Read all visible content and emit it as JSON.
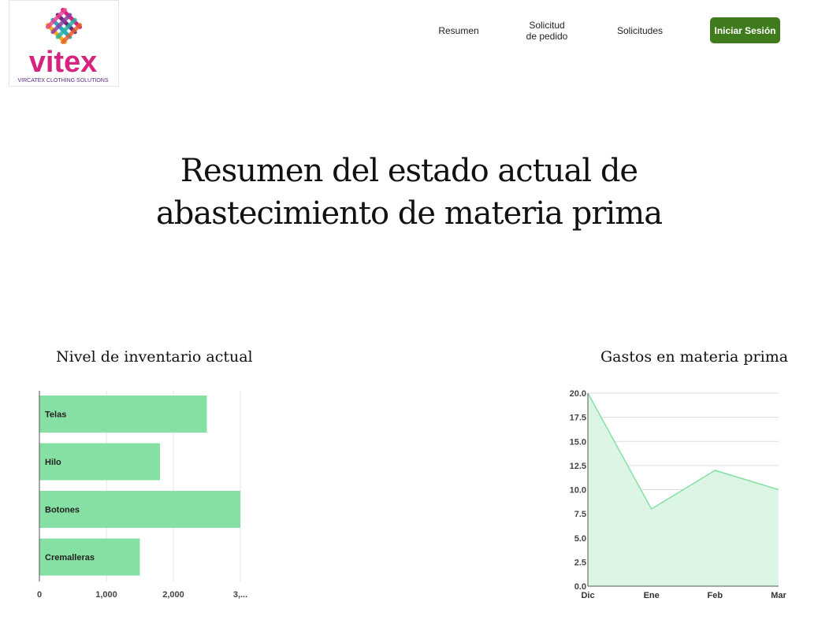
{
  "logo": {
    "word": "vitex",
    "tagline": "VIRCATEX CLOTHING SOLUTIONS"
  },
  "nav": {
    "items": [
      {
        "label": "Resumen"
      },
      {
        "label_line1": "Solicitud",
        "label_line2": "de pedido"
      },
      {
        "label": "Solicitudes"
      }
    ],
    "login_label": "Iniciar Sesión"
  },
  "hero": {
    "line1": "Resumen del estado actual de",
    "line2": "abastecimiento de materia prima"
  },
  "colors": {
    "accent_green": "#3f7a1d",
    "bar_green": "#86e0a3",
    "area_green": "#dcf5e4",
    "line_green": "#86e0a3",
    "logo_magenta": "#d6247e"
  },
  "chart_data": [
    {
      "type": "bar",
      "orientation": "horizontal",
      "title": "Nivel de inventario actual",
      "categories": [
        "Telas",
        "Hilo",
        "Botones",
        "Cremalleras"
      ],
      "values": [
        2500,
        1800,
        3000,
        1500
      ],
      "xlim": [
        0,
        3000
      ],
      "x_ticks": [
        "0",
        "1,000",
        "2,000",
        "3,..."
      ],
      "grid": true
    },
    {
      "type": "area",
      "title": "Gastos en materia prima",
      "categories": [
        "Dic",
        "Ene",
        "Feb",
        "Mar"
      ],
      "values": [
        20,
        8,
        12,
        10
      ],
      "ylim": [
        0,
        20
      ],
      "y_ticks": [
        "0.0",
        "2.5",
        "5.0",
        "7.5",
        "10.0",
        "12.5",
        "15.0",
        "17.5",
        "20.0"
      ],
      "grid": true
    }
  ]
}
